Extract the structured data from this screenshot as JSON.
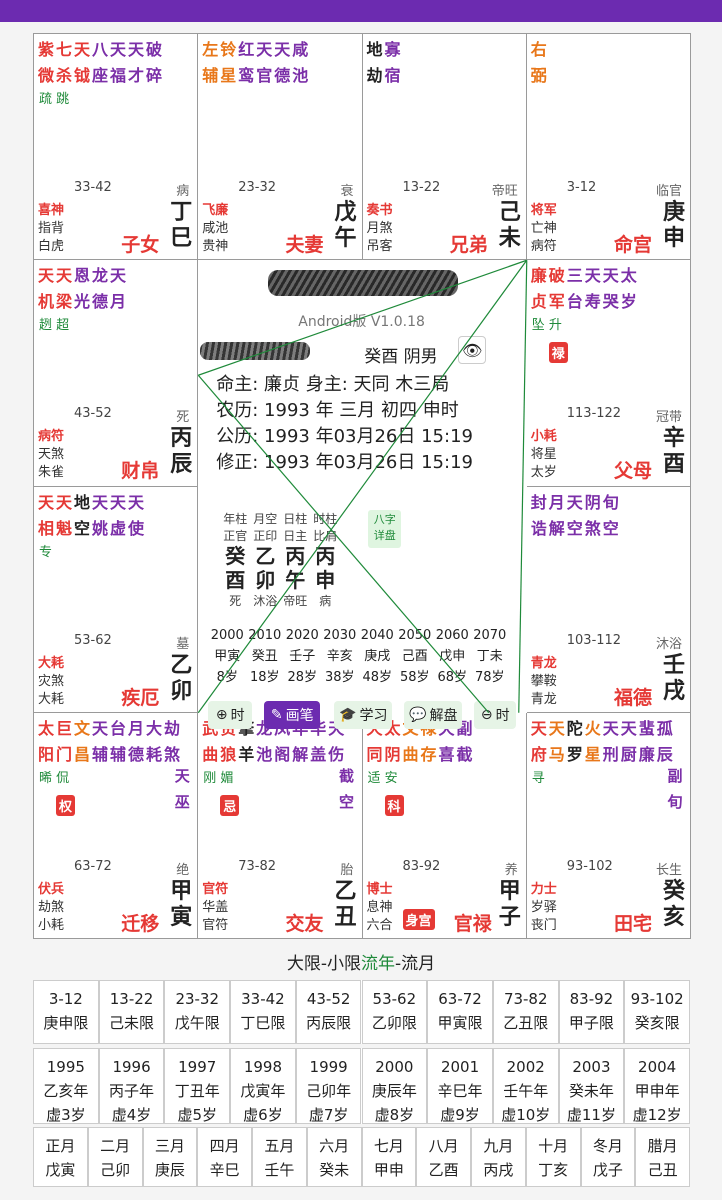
{
  "app": {
    "version": "Android版 V1.0.18"
  },
  "palaces": [
    {
      "id": "si",
      "stars": [
        [
          "紫",
          "微",
          "main"
        ],
        [
          "七",
          "杀",
          "main"
        ],
        [
          "天",
          "钺",
          "main"
        ],
        [
          "八",
          "座",
          "purple"
        ],
        [
          "天",
          "福",
          "purple"
        ],
        [
          "天",
          "才",
          "purple"
        ],
        [
          "破",
          "碎",
          "purple"
        ]
      ],
      "extra": "疏 跳",
      "range": "33-42",
      "life": "病",
      "g1": "喜神",
      "g2": "指背",
      "g3": "白虎",
      "palace": "子女",
      "gz": [
        "丁",
        "巳"
      ]
    },
    {
      "id": "wu",
      "stars": [
        [
          "左",
          "辅",
          "orange"
        ],
        [
          "铃",
          "星",
          "orange"
        ],
        [
          "红",
          "鸾",
          "purple"
        ],
        [
          "天",
          "官",
          "purple"
        ],
        [
          "天",
          "德",
          "purple"
        ],
        [
          "咸",
          "池",
          "purple"
        ]
      ],
      "extra": "",
      "range": "23-32",
      "life": "衰",
      "g1": "飞廉",
      "g2": "咸池",
      "g3": "贵神",
      "palace": "夫妻",
      "gz": [
        "戊",
        "午"
      ]
    },
    {
      "id": "wei",
      "stars": [
        [
          "地",
          "劫",
          "black"
        ],
        [
          "寡",
          "宿",
          "purple"
        ]
      ],
      "extra": "",
      "range": "13-22",
      "life": "帝旺",
      "g1": "奏书",
      "g2": "月煞",
      "g3": "吊客",
      "palace": "兄弟",
      "gz": [
        "己",
        "未"
      ]
    },
    {
      "id": "shen",
      "stars": [
        [
          "右",
          "弼",
          "orange"
        ]
      ],
      "extra": "",
      "range": "3-12",
      "life": "临官",
      "g1": "将军",
      "g2": "亡神",
      "g3": "病符",
      "palace": "命宫",
      "gz": [
        "庚",
        "申"
      ]
    },
    {
      "id": "chen",
      "stars": [
        [
          "天",
          "机",
          "main"
        ],
        [
          "天",
          "梁",
          "main"
        ],
        [
          "恩",
          "光",
          "purple"
        ],
        [
          "龙",
          "德",
          "purple"
        ],
        [
          "天",
          "月",
          "purple"
        ]
      ],
      "extra": "趔 超",
      "range": "43-52",
      "life": "死",
      "g1": "病符",
      "g2": "天煞",
      "g3": "朱雀",
      "palace": "财帛",
      "gz": [
        "丙",
        "辰"
      ]
    },
    {
      "id": "you",
      "stars": [
        [
          "廉",
          "贞",
          "main"
        ],
        [
          "破",
          "军",
          "main"
        ],
        [
          "三",
          "台",
          "purple"
        ],
        [
          "天",
          "寿",
          "purple"
        ],
        [
          "天",
          "哭",
          "purple"
        ],
        [
          "太",
          "岁",
          "purple"
        ]
      ],
      "extra": "坠 升",
      "sihua": "禄",
      "range": "113-122",
      "life": "冠带",
      "g1": "小耗",
      "g2": "将星",
      "g3": "太岁",
      "palace": "父母",
      "gz": [
        "辛",
        "酉"
      ]
    },
    {
      "id": "mao",
      "stars": [
        [
          "天",
          "相",
          "main"
        ],
        [
          "天",
          "魁",
          "main"
        ],
        [
          "地",
          "空",
          "black"
        ],
        [
          "天",
          "姚",
          "purple"
        ],
        [
          "天",
          "虚",
          "purple"
        ],
        [
          "天",
          "使",
          "purple"
        ]
      ],
      "extra": "专",
      "range": "53-62",
      "life": "墓",
      "g1": "大耗",
      "g2": "灾煞",
      "g3": "大耗",
      "palace": "疾厄",
      "gz": [
        "乙",
        "卯"
      ]
    },
    {
      "id": "xu",
      "stars": [
        [
          "封",
          "诰",
          "purple"
        ],
        [
          "月",
          "解",
          "purple"
        ],
        [
          "天",
          "空",
          "purple"
        ],
        [
          "阴",
          "煞",
          "purple"
        ],
        [
          "旬",
          "空",
          "purple"
        ]
      ],
      "extra": "",
      "range": "103-112",
      "life": "沐浴",
      "g1": "青龙",
      "g2": "攀鞍",
      "g3": "青龙",
      "palace": "福德",
      "gz": [
        "壬",
        "戌"
      ]
    },
    {
      "id": "yin",
      "stars": [
        [
          "太",
          "阳",
          "main"
        ],
        [
          "巨",
          "门",
          "main"
        ],
        [
          "文",
          "昌",
          "orange"
        ],
        [
          "天",
          "辅",
          "purple"
        ],
        [
          "台",
          "辅",
          "purple"
        ],
        [
          "月",
          "德",
          "purple"
        ],
        [
          "大",
          "耗",
          "purple"
        ],
        [
          "劫",
          "煞",
          "purple"
        ]
      ],
      "extra": "晞 侃",
      "sihua": "权",
      "rv": [
        "天",
        "巫"
      ],
      "range": "63-72",
      "life": "绝",
      "g1": "伏兵",
      "g2": "劫煞",
      "g3": "小耗",
      "palace": "迁移",
      "gz": [
        "甲",
        "寅"
      ]
    },
    {
      "id": "chou",
      "stars": [
        [
          "武",
          "曲",
          "main"
        ],
        [
          "贪",
          "狼",
          "main"
        ],
        [
          "擎",
          "羊",
          "black"
        ],
        [
          "龙",
          "池",
          "purple"
        ],
        [
          "凤",
          "阁",
          "purple"
        ],
        [
          "年",
          "解",
          "purple"
        ],
        [
          "华",
          "盖",
          "purple"
        ],
        [
          "天",
          "伤",
          "purple"
        ]
      ],
      "extra": "刚 媚",
      "sihua": "忌",
      "rv": [
        "截",
        "空"
      ],
      "range": "73-82",
      "life": "胎",
      "g1": "官符",
      "g2": "华盖",
      "g3": "官符",
      "palace": "交友",
      "gz": [
        "乙",
        "丑"
      ]
    },
    {
      "id": "zi",
      "stars": [
        [
          "天",
          "同",
          "main"
        ],
        [
          "太",
          "阴",
          "main"
        ],
        [
          "文",
          "曲",
          "orange"
        ],
        [
          "禄",
          "存",
          "orange"
        ],
        [
          "天",
          "喜",
          "purple"
        ],
        [
          "副",
          "截",
          "purple"
        ]
      ],
      "extra": "适 安",
      "sihua": "科",
      "range": "83-92",
      "life": "养",
      "g1": "博士",
      "g2": "息神",
      "g3": "六合",
      "palace": "官禄",
      "gz": [
        "甲",
        "子"
      ],
      "shengong": "身宫"
    },
    {
      "id": "hai",
      "stars": [
        [
          "天",
          "府",
          "main"
        ],
        [
          "天",
          "马",
          "orange"
        ],
        [
          "陀",
          "罗",
          "black"
        ],
        [
          "火",
          "星",
          "orange"
        ],
        [
          "天",
          "刑",
          "purple"
        ],
        [
          "天",
          "厨",
          "purple"
        ],
        [
          "蜚",
          "廉",
          "purple"
        ],
        [
          "孤",
          "辰",
          "purple"
        ]
      ],
      "extra": "寻",
      "rv": [
        "副",
        "旬"
      ],
      "range": "93-102",
      "life": "长生",
      "g1": "力士",
      "g2": "岁驿",
      "g3": "丧门",
      "palace": "田宅",
      "gz": [
        "癸",
        "亥"
      ]
    }
  ],
  "center": {
    "year_sex": "癸酉  阴男",
    "lines": [
      "命主: 廉贞   身主: 天同   木三局",
      "农历: 1993 年 三月 初四 申时",
      "公历: 1993 年03月26日 15:19",
      "修正: 1993 年03月26日 15:19"
    ],
    "pillars": [
      {
        "h1": "年柱",
        "h2": "正官",
        "g": "癸",
        "z": "酉",
        "s": "死"
      },
      {
        "h1": "月空",
        "h2": "正印",
        "g": "乙",
        "z": "卯",
        "s": "沐浴"
      },
      {
        "h1": "日柱",
        "h2": "日主",
        "g": "丙",
        "z": "午",
        "s": "帝旺"
      },
      {
        "h1": "时柱",
        "h2": "比肩",
        "g": "丙",
        "z": "申",
        "s": "病"
      }
    ],
    "bazi_btn": "八字\n详盘",
    "dayun_years": [
      "2000",
      "2010",
      "2020",
      "2030",
      "2040",
      "2050",
      "2060",
      "2070"
    ],
    "dayun_gz": [
      "甲寅",
      "癸丑",
      "壬子",
      "辛亥",
      "庚戌",
      "己酉",
      "戊申",
      "丁未"
    ],
    "dayun_age": [
      "8岁",
      "18岁",
      "28岁",
      "38岁",
      "48岁",
      "58岁",
      "68岁",
      "78岁"
    ],
    "buttons": [
      "时",
      "画笔",
      "学习",
      "解盘",
      "时"
    ]
  },
  "section_title": {
    "a": "大限-小限",
    "b": "流年",
    "c": "-流月"
  },
  "daxian": [
    [
      "3-12",
      "庚申限"
    ],
    [
      "13-22",
      "己未限"
    ],
    [
      "23-32",
      "戊午限"
    ],
    [
      "33-42",
      "丁巳限"
    ],
    [
      "43-52",
      "丙辰限"
    ],
    [
      "53-62",
      "乙卯限"
    ],
    [
      "63-72",
      "甲寅限"
    ],
    [
      "73-82",
      "乙丑限"
    ],
    [
      "83-92",
      "甲子限"
    ],
    [
      "93-102",
      "癸亥限"
    ]
  ],
  "liunian": [
    [
      "1995",
      "乙亥年",
      "虚3岁"
    ],
    [
      "1996",
      "丙子年",
      "虚4岁"
    ],
    [
      "1997",
      "丁丑年",
      "虚5岁"
    ],
    [
      "1998",
      "戊寅年",
      "虚6岁"
    ],
    [
      "1999",
      "己卯年",
      "虚7岁"
    ],
    [
      "2000",
      "庚辰年",
      "虚8岁"
    ],
    [
      "2001",
      "辛巳年",
      "虚9岁"
    ],
    [
      "2002",
      "壬午年",
      "虚10岁"
    ],
    [
      "2003",
      "癸未年",
      "虚11岁"
    ],
    [
      "2004",
      "甲申年",
      "虚12岁"
    ]
  ],
  "liuyue": [
    [
      "正月",
      "戊寅"
    ],
    [
      "二月",
      "己卯"
    ],
    [
      "三月",
      "庚辰"
    ],
    [
      "四月",
      "辛巳"
    ],
    [
      "五月",
      "壬午"
    ],
    [
      "六月",
      "癸未"
    ],
    [
      "七月",
      "甲申"
    ],
    [
      "八月",
      "乙酉"
    ],
    [
      "九月",
      "丙戌"
    ],
    [
      "十月",
      "丁亥"
    ],
    [
      "冬月",
      "戊子"
    ],
    [
      "腊月",
      "己丑"
    ]
  ]
}
